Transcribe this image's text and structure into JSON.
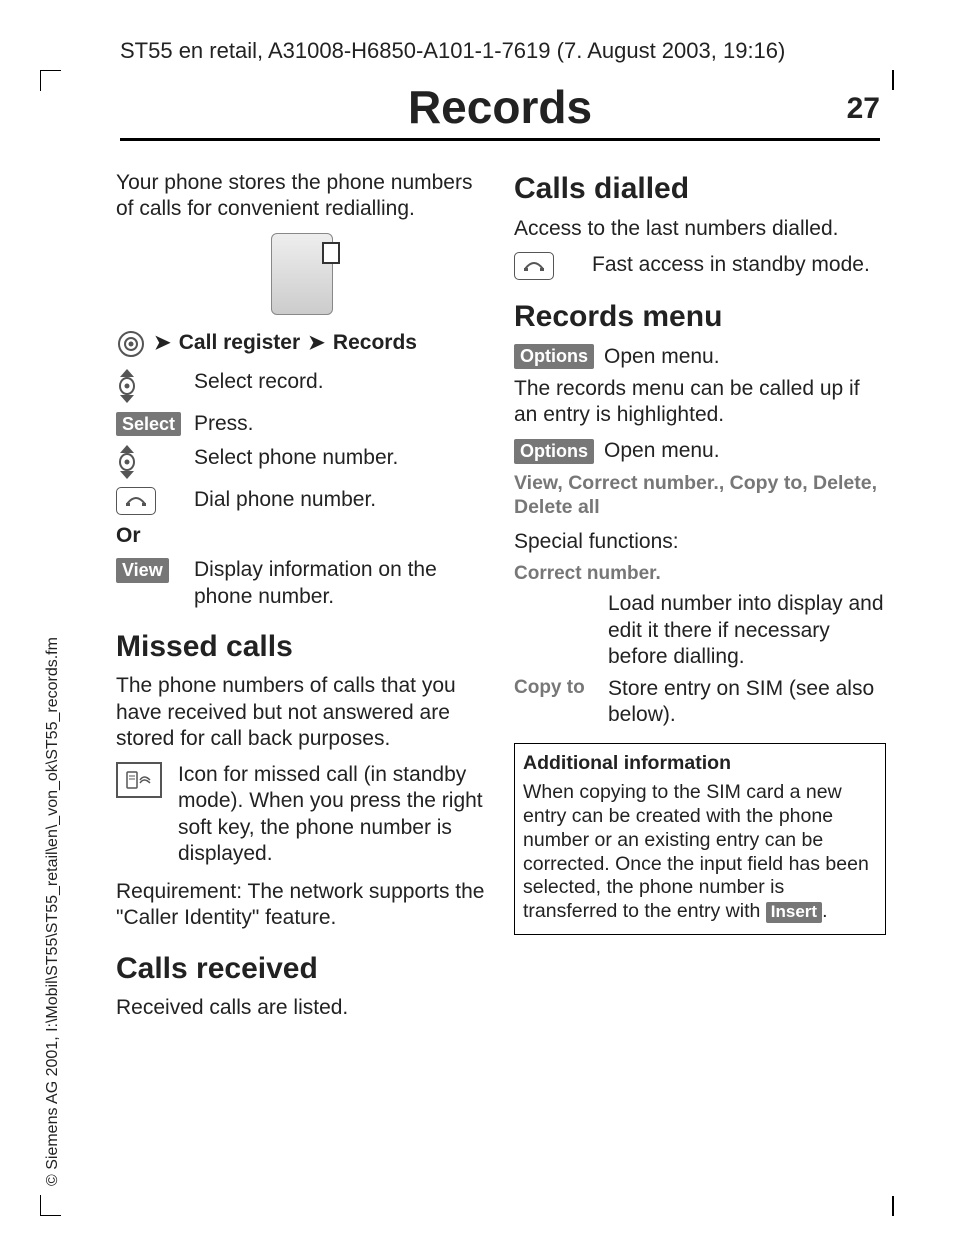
{
  "header": {
    "path": "ST55 en retail, A31008-H6850-A101-1-7619 (7. August 2003, 19:16)",
    "title": "Records",
    "page_number": "27"
  },
  "sidebar_text": "© Siemens AG 2001, I:\\Mobil\\ST55\\ST55_retail\\en\\_von_ok\\ST55_records.fm",
  "left": {
    "intro": "Your phone stores the phone numbers of calls for convenient redialling.",
    "nav": {
      "item1": "Call register",
      "item2": "Records"
    },
    "steps": {
      "select_record": "Select record.",
      "select_softkey": "Select",
      "press": "Press.",
      "select_phone": "Select phone number.",
      "dial": "Dial phone number."
    },
    "or_label": "Or",
    "view_softkey": "View",
    "view_desc": "Display information on the phone number.",
    "missed": {
      "heading": "Missed calls",
      "desc": "The phone numbers of calls that you have received but not answered are stored for call back purposes.",
      "icon_desc": "Icon for missed call (in standby mode). When you press the right soft key, the phone number is displayed.",
      "requirement": "Requirement: The network supports the \"Caller Identity\" feature."
    },
    "received": {
      "heading": "Calls received",
      "desc": "Received calls are listed."
    }
  },
  "right": {
    "dialled": {
      "heading": "Calls dialled",
      "desc": "Access to the last numbers dialled.",
      "fast_access": "Fast access in standby mode."
    },
    "menu": {
      "heading": "Records menu",
      "options_label": "Options",
      "open_menu": "Open menu.",
      "desc1": "The records menu can be called up if an entry is highlighted.",
      "list": "View, Correct number., Copy to, Delete, Delete all",
      "special_heading": "Special functions:",
      "correct_label": "Correct number.",
      "correct_desc": "Load number into display and edit it there if necessary before dialling.",
      "copy_label": "Copy to",
      "copy_desc": "Store entry on SIM (see also below)."
    },
    "info": {
      "title": "Additional information",
      "body_before": "When copying to the SIM card a new entry can be created with the phone number or an existing entry can be corrected. Once the input field has been selected, the phone number is transferred to the entry with ",
      "insert_label": "Insert",
      "body_after": "."
    }
  }
}
